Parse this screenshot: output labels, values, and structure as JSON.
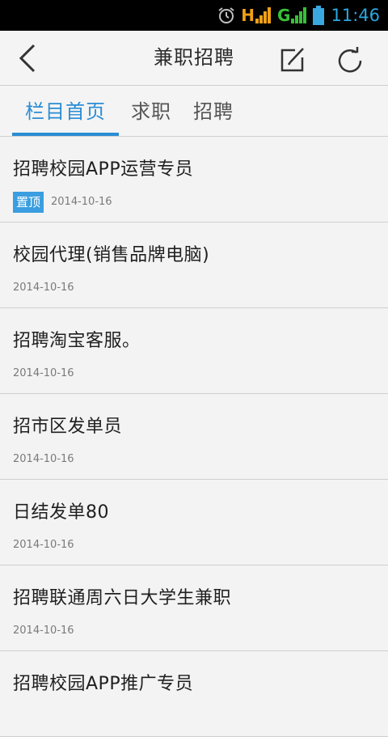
{
  "status_bar": {
    "time": "11:46",
    "network_1": "H",
    "network_2": "G",
    "icons": [
      "alarm-icon",
      "signal-icon",
      "battery-icon"
    ],
    "colors": {
      "network_1": "#f0a018",
      "network_2": "#38c038",
      "clock": "#2aa8e0"
    }
  },
  "header": {
    "title": "兼职招聘",
    "icons": [
      "chevron-left-icon",
      "edit-icon",
      "refresh-icon"
    ]
  },
  "tabs": [
    {
      "label": "栏目首页",
      "active": true
    },
    {
      "label": "求职",
      "active": false
    },
    {
      "label": "招聘",
      "active": false
    }
  ],
  "accent_color": "#2a8dd4",
  "items": [
    {
      "title": "招聘校园APP运营专员",
      "badge": "置顶",
      "date": "2014-10-16"
    },
    {
      "title": "校园代理(销售品牌电脑)",
      "badge": "",
      "date": "2014-10-16"
    },
    {
      "title": "招聘淘宝客服。",
      "badge": "",
      "date": "2014-10-16"
    },
    {
      "title": "招市区发单员",
      "badge": "",
      "date": "2014-10-16"
    },
    {
      "title": "日结发单80",
      "badge": "",
      "date": "2014-10-16"
    },
    {
      "title": "招聘联通周六日大学生兼职",
      "badge": "",
      "date": "2014-10-16"
    },
    {
      "title": "招聘校园APP推广专员",
      "badge": "",
      "date": ""
    }
  ]
}
